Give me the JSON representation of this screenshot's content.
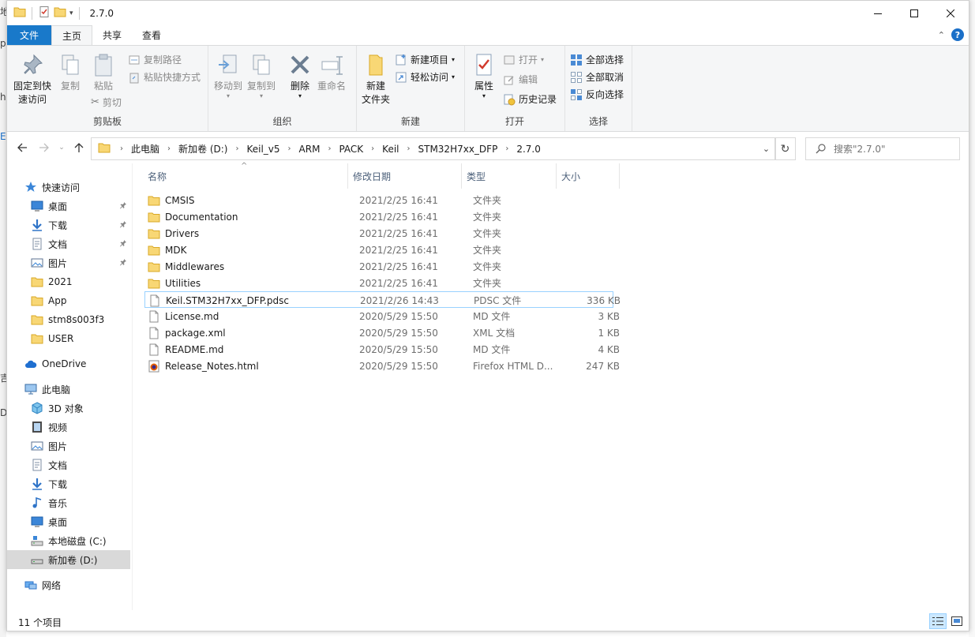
{
  "window": {
    "title": "2.7.0",
    "caption": {
      "minimize": "—",
      "maximize": "☐",
      "close": "✕"
    }
  },
  "behind_window": {
    "chars": [
      "地",
      "p",
      "h",
      "E",
      "吉",
      "D"
    ]
  },
  "ribbon_tabs": [
    "文件",
    "主页",
    "共享",
    "查看"
  ],
  "ribbon": {
    "clipboard": {
      "label": "剪贴板",
      "pin_quick_access": [
        "固定到快",
        "速访问"
      ],
      "copy": "复制",
      "paste": "粘贴",
      "copy_path": "复制路径",
      "paste_shortcut": "粘贴快捷方式",
      "cut": "剪切"
    },
    "organize": {
      "label": "组织",
      "move_to": "移动到",
      "copy_to": "复制到",
      "delete": "删除",
      "rename": "重命名"
    },
    "new": {
      "label": "新建",
      "new_folder": [
        "新建",
        "文件夹"
      ],
      "new_item": "新建项目",
      "easy_access": "轻松访问"
    },
    "open": {
      "label": "打开",
      "properties": "属性",
      "open": "打开",
      "edit": "编辑",
      "history": "历史记录"
    },
    "select": {
      "label": "选择",
      "select_all": "全部选择",
      "select_none": "全部取消",
      "invert": "反向选择"
    }
  },
  "address": {
    "breadcrumbs": [
      "此电脑",
      "新加卷 (D:)",
      "Keil_v5",
      "ARM",
      "PACK",
      "Keil",
      "STM32H7xx_DFP",
      "2.7.0"
    ],
    "search_placeholder": "搜索\"2.7.0\""
  },
  "nav_pane": [
    {
      "label": "快速访问",
      "icon": "star-icon",
      "indent": 0,
      "pinned": false
    },
    {
      "label": "桌面",
      "icon": "desktop-icon",
      "indent": 1,
      "pinned": true
    },
    {
      "label": "下载",
      "icon": "download-icon",
      "indent": 1,
      "pinned": true
    },
    {
      "label": "文档",
      "icon": "document-icon",
      "indent": 1,
      "pinned": true
    },
    {
      "label": "图片",
      "icon": "pictures-icon",
      "indent": 1,
      "pinned": true
    },
    {
      "label": "2021",
      "icon": "folder-icon",
      "indent": 1,
      "pinned": false
    },
    {
      "label": "App",
      "icon": "folder-icon",
      "indent": 1,
      "pinned": false
    },
    {
      "label": "stm8s003f3",
      "icon": "folder-icon",
      "indent": 1,
      "pinned": false
    },
    {
      "label": "USER",
      "icon": "folder-icon",
      "indent": 1,
      "pinned": false
    },
    {
      "label": "OneDrive",
      "icon": "cloud-icon",
      "indent": 0,
      "pinned": false
    },
    {
      "label": "此电脑",
      "icon": "computer-icon",
      "indent": 0,
      "pinned": false
    },
    {
      "label": "3D 对象",
      "icon": "3d-objects-icon",
      "indent": 1,
      "pinned": false
    },
    {
      "label": "视频",
      "icon": "video-icon",
      "indent": 1,
      "pinned": false
    },
    {
      "label": "图片",
      "icon": "pictures-icon",
      "indent": 1,
      "pinned": false
    },
    {
      "label": "文档",
      "icon": "document-icon",
      "indent": 1,
      "pinned": false
    },
    {
      "label": "下载",
      "icon": "download-icon",
      "indent": 1,
      "pinned": false
    },
    {
      "label": "音乐",
      "icon": "music-icon",
      "indent": 1,
      "pinned": false
    },
    {
      "label": "桌面",
      "icon": "desktop-icon",
      "indent": 1,
      "pinned": false
    },
    {
      "label": "本地磁盘 (C:)",
      "icon": "system-drive-icon",
      "indent": 1,
      "pinned": false
    },
    {
      "label": "新加卷 (D:)",
      "icon": "drive-icon",
      "indent": 1,
      "pinned": false,
      "selected": true
    },
    {
      "label": "网络",
      "icon": "network-icon",
      "indent": 0,
      "pinned": false
    }
  ],
  "columns": {
    "name": "名称",
    "date": "修改日期",
    "type": "类型",
    "size": "大小"
  },
  "files": [
    {
      "name": "CMSIS",
      "date": "2021/2/25 16:41",
      "type": "文件夹",
      "size": "",
      "icon": "folder-icon"
    },
    {
      "name": "Documentation",
      "date": "2021/2/25 16:41",
      "type": "文件夹",
      "size": "",
      "icon": "folder-icon"
    },
    {
      "name": "Drivers",
      "date": "2021/2/25 16:41",
      "type": "文件夹",
      "size": "",
      "icon": "folder-icon"
    },
    {
      "name": "MDK",
      "date": "2021/2/25 16:41",
      "type": "文件夹",
      "size": "",
      "icon": "folder-icon"
    },
    {
      "name": "Middlewares",
      "date": "2021/2/25 16:41",
      "type": "文件夹",
      "size": "",
      "icon": "folder-icon"
    },
    {
      "name": "Utilities",
      "date": "2021/2/25 16:41",
      "type": "文件夹",
      "size": "",
      "icon": "folder-icon"
    },
    {
      "name": "Keil.STM32H7xx_DFP.pdsc",
      "date": "2021/2/26 14:43",
      "type": "PDSC 文件",
      "size": "336 KB",
      "icon": "file-icon",
      "focused": true
    },
    {
      "name": "License.md",
      "date": "2020/5/29 15:50",
      "type": "MD 文件",
      "size": "3 KB",
      "icon": "file-icon"
    },
    {
      "name": "package.xml",
      "date": "2020/5/29 15:50",
      "type": "XML 文档",
      "size": "1 KB",
      "icon": "file-icon"
    },
    {
      "name": "README.md",
      "date": "2020/5/29 15:50",
      "type": "MD 文件",
      "size": "4 KB",
      "icon": "file-icon"
    },
    {
      "name": "Release_Notes.html",
      "date": "2020/5/29 15:50",
      "type": "Firefox HTML D...",
      "size": "247 KB",
      "icon": "html-file-icon"
    }
  ],
  "status": {
    "item_count": "11 个项目"
  },
  "colors": {
    "file_tab": "#1979ca",
    "folder": "#f8d775",
    "ribbon_bg": "#f5f6f7",
    "header_text": "#4c607a"
  }
}
